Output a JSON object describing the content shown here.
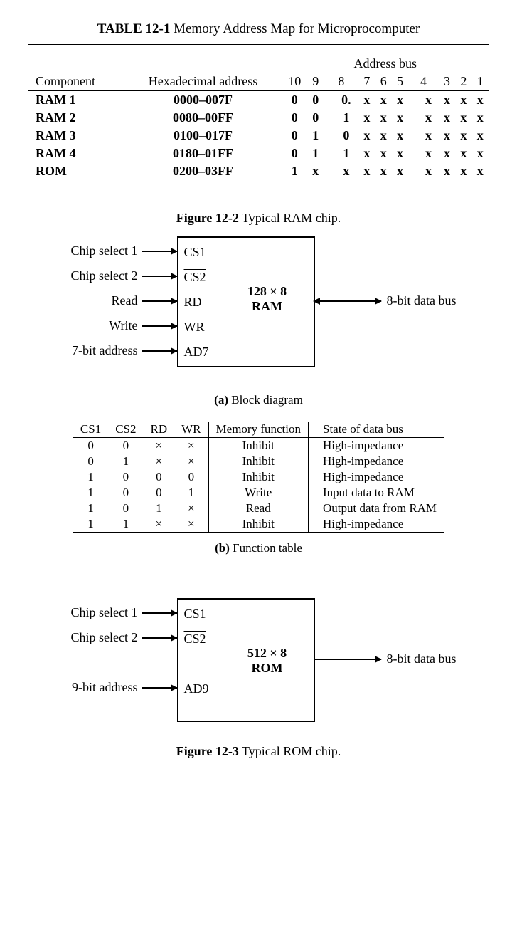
{
  "table121": {
    "title_prefix": "TABLE 12-1",
    "title_rest": " Memory Address Map for Microprocomputer",
    "headers": {
      "component": "Component",
      "hex": "Hexadecimal address",
      "addrbus": "Address bus",
      "bits": [
        "10",
        "9",
        "8",
        "7",
        "6",
        "5",
        "4",
        "3",
        "2",
        "1"
      ]
    },
    "rows": [
      {
        "comp": "RAM 1",
        "hex": "0000–007F",
        "b": [
          "0",
          "0",
          "0.",
          "x",
          "x",
          "x",
          "x",
          "x",
          "x",
          "x"
        ]
      },
      {
        "comp": "RAM 2",
        "hex": "0080–00FF",
        "b": [
          "0",
          "0",
          "1",
          "x",
          "x",
          "x",
          "x",
          "x",
          "x",
          "x"
        ]
      },
      {
        "comp": "RAM 3",
        "hex": "0100–017F",
        "b": [
          "0",
          "1",
          "0",
          "x",
          "x",
          "x",
          "x",
          "x",
          "x",
          "x"
        ]
      },
      {
        "comp": "RAM 4",
        "hex": "0180–01FF",
        "b": [
          "0",
          "1",
          "1",
          "x",
          "x",
          "x",
          "x",
          "x",
          "x",
          "x"
        ]
      },
      {
        "comp": "ROM",
        "hex": "0200–03FF",
        "b": [
          "1",
          "x",
          "x",
          "x",
          "x",
          "x",
          "x",
          "x",
          "x",
          "x"
        ]
      }
    ]
  },
  "fig122": {
    "caption_prefix": "Figure 12-2",
    "caption_rest": "   Typical RAM chip.",
    "pins": {
      "cs1": "Chip select 1",
      "cs2": "Chip select 2",
      "rd": "Read",
      "wr": "Write",
      "ad": "7-bit address"
    },
    "inside": {
      "cs1": "CS1",
      "cs2": "CS2",
      "rd": "RD",
      "wr": "WR",
      "ad": "AD7"
    },
    "chip": "128 × 8\nRAM",
    "out": "8-bit data bus",
    "sub_a_prefix": "(a)",
    "sub_a_rest": "   Block diagram",
    "sub_b_prefix": "(b)",
    "sub_b_rest": "   Function table"
  },
  "func": {
    "headers": [
      "CS1",
      "CS2",
      "RD",
      "WR",
      "Memory function",
      "State of data bus"
    ],
    "rows": [
      [
        "0",
        "0",
        "×",
        "×",
        "Inhibit",
        "High-impedance"
      ],
      [
        "0",
        "1",
        "×",
        "×",
        "Inhibit",
        "High-impedance"
      ],
      [
        "1",
        "0",
        "0",
        "0",
        "Inhibit",
        "High-impedance"
      ],
      [
        "1",
        "0",
        "0",
        "1",
        "Write",
        "Input data to RAM"
      ],
      [
        "1",
        "0",
        "1",
        "×",
        "Read",
        "Output data from RAM"
      ],
      [
        "1",
        "1",
        "×",
        "×",
        "Inhibit",
        "High-impedance"
      ]
    ]
  },
  "fig123": {
    "caption_prefix": "Figure 12-3",
    "caption_rest": "   Typical ROM chip.",
    "pins": {
      "cs1": "Chip select 1",
      "cs2": "Chip select 2",
      "ad": "9-bit address"
    },
    "inside": {
      "cs1": "CS1",
      "cs2": "CS2",
      "ad": "AD9"
    },
    "chip": "512 × 8\nROM",
    "out": "8-bit data bus"
  }
}
